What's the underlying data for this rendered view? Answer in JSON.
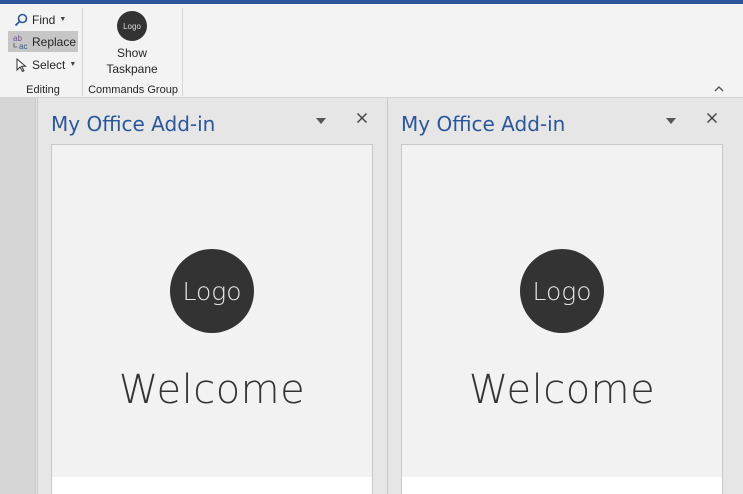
{
  "ribbon": {
    "editing": {
      "find_label": "Find",
      "replace_label": "Replace",
      "replace_icon_text": "ab→ac",
      "select_label": "Select",
      "group_label": "Editing"
    },
    "commands": {
      "logo_text": "Logo",
      "show_taskpane_line1": "Show",
      "show_taskpane_line2": "Taskpane",
      "group_label": "Commands Group"
    },
    "accent_color": "#2b579a"
  },
  "panes": [
    {
      "title": "My Office Add-in",
      "logo_text": "Logo",
      "welcome_text": "Welcome"
    },
    {
      "title": "My Office Add-in",
      "logo_text": "Logo",
      "welcome_text": "Welcome"
    }
  ],
  "icons": {
    "find": "magnifier-icon",
    "replace": "replace-icon",
    "select": "cursor-icon",
    "menu": "chevron-down-icon",
    "close": "close-icon",
    "collapse": "chevron-up-icon"
  }
}
